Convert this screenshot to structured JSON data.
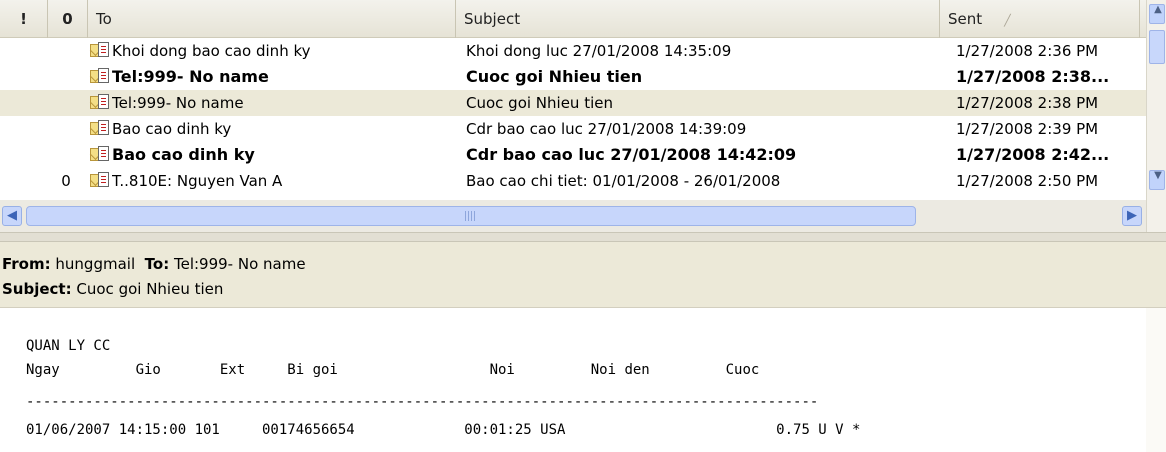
{
  "list": {
    "headers": {
      "importance": "!",
      "attachment": "0",
      "to": "To",
      "subject": "Subject",
      "sent": "Sent"
    },
    "rows": [
      {
        "to": "Khoi dong bao cao dinh ky",
        "subject": "Khoi dong luc 27/01/2008 14:35:09",
        "sent": "1/27/2008 2:36 PM",
        "attachment": ""
      },
      {
        "to": "Tel:999- No name",
        "subject": "Cuoc goi Nhieu tien",
        "sent": "1/27/2008 2:38...",
        "attachment": ""
      },
      {
        "to": "Tel:999- No name",
        "subject": "Cuoc goi Nhieu tien",
        "sent": "1/27/2008 2:38 PM",
        "attachment": ""
      },
      {
        "to": "Bao cao dinh ky",
        "subject": "Cdr bao cao luc 27/01/2008 14:39:09",
        "sent": "1/27/2008 2:39 PM",
        "attachment": ""
      },
      {
        "to": "Bao cao dinh ky",
        "subject": "Cdr bao cao luc 27/01/2008 14:42:09",
        "sent": "1/27/2008 2:42...",
        "attachment": ""
      },
      {
        "to": "T..810E: Nguyen Van A",
        "subject": "Bao cao chi tiet: 01/01/2008 - 26/01/2008",
        "sent": "1/27/2008 2:50 PM",
        "attachment": "0"
      }
    ]
  },
  "preview": {
    "from_label": "From:",
    "from_value": "hunggmail",
    "to_label": "To:",
    "to_value": "Tel:999- No name",
    "subject_label": "Subject:",
    "subject_value": "Cuoc goi Nhieu tien",
    "body_lines": [
      "QUAN LY CC",
      "Ngay         Gio       Ext     Bi goi                  Noi         Noi den         Cuoc",
      "----------------------------------------------------------------------------------------------",
      "01/06/2007 14:15:00 101     00174656654             00:01:25 USA                         0.75 U V *"
    ]
  },
  "colors": {
    "selected_row": "#ece9d8",
    "header_bg": "#ece9d8",
    "scroll_blue": "#c7d6fb"
  }
}
